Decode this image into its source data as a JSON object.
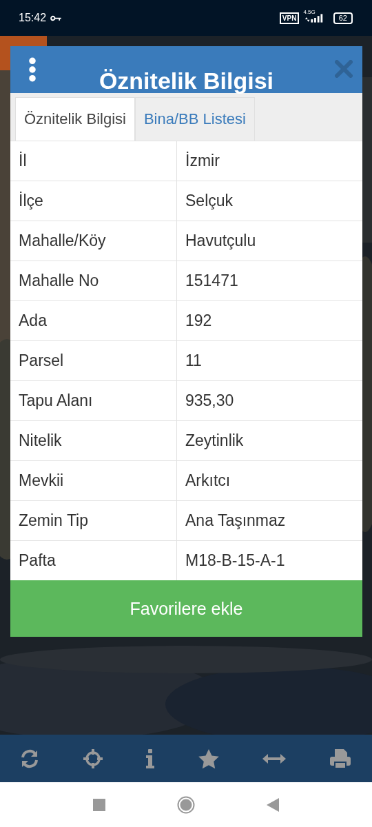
{
  "status_bar": {
    "time": "15:42",
    "vpn": "VPN",
    "network": "4.5G",
    "battery": "62"
  },
  "dialog": {
    "title": "Öznitelik Bilgisi",
    "tabs": [
      {
        "label": "Öznitelik Bilgisi",
        "selected": true
      },
      {
        "label": "Bina/BB Listesi",
        "selected": false
      }
    ],
    "rows": [
      {
        "label": "İl",
        "value": "İzmir"
      },
      {
        "label": "İlçe",
        "value": "Selçuk"
      },
      {
        "label": "Mahalle/Köy",
        "value": "Havutçulu"
      },
      {
        "label": "Mahalle No",
        "value": "151471"
      },
      {
        "label": "Ada",
        "value": "192"
      },
      {
        "label": "Parsel",
        "value": "11"
      },
      {
        "label": "Tapu Alanı",
        "value": "935,30"
      },
      {
        "label": "Nitelik",
        "value": "Zeytinlik"
      },
      {
        "label": "Mevkii",
        "value": "Arkıtcı"
      },
      {
        "label": "Zemin Tip",
        "value": "Ana Taşınmaz"
      },
      {
        "label": "Pafta",
        "value": "M18-B-15-A-1"
      }
    ],
    "button": "Favorilere ekle"
  }
}
